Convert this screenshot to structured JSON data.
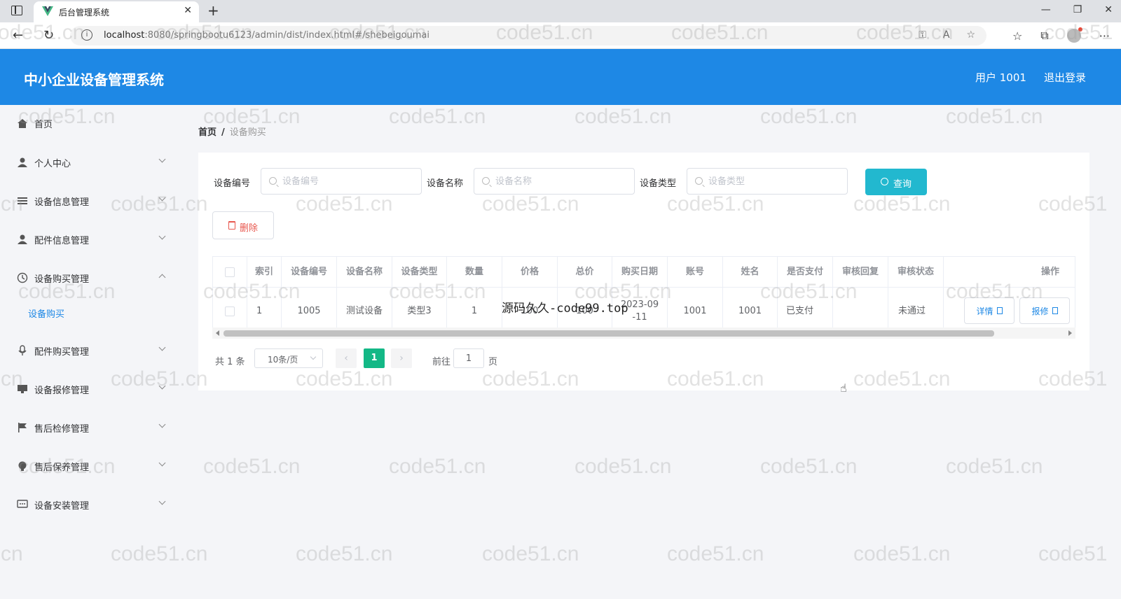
{
  "browser": {
    "tab_title": "后台管理系统",
    "url_host": "localhost",
    "url_rest": ":8080/springbootu6123/admin/dist/index.html#/shebeigoumai"
  },
  "header": {
    "title": "中小企业设备管理系统",
    "user": "用户 1001",
    "logout": "退出登录",
    "color": "#1e88e5"
  },
  "sidebar": {
    "items": [
      {
        "label": "首页",
        "icon": "home-icon"
      },
      {
        "label": "个人中心",
        "icon": "user-icon"
      },
      {
        "label": "设备信息管理",
        "icon": "list-icon"
      },
      {
        "label": "配件信息管理",
        "icon": "user-icon"
      },
      {
        "label": "设备购买管理",
        "icon": "clock-icon"
      },
      {
        "label": "配件购买管理",
        "icon": "mic-icon"
      },
      {
        "label": "设备报修管理",
        "icon": "monitor-icon"
      },
      {
        "label": "售后检修管理",
        "icon": "flag-icon"
      },
      {
        "label": "售后保养管理",
        "icon": "bulb-icon"
      },
      {
        "label": "设备安装管理",
        "icon": "chat-icon"
      }
    ],
    "active_sub": "设备购买"
  },
  "breadcrumb": {
    "home": "首页",
    "sep": "/",
    "current": "设备购买"
  },
  "search": {
    "field1_label": "设备编号",
    "field1_placeholder": "设备编号",
    "field2_label": "设备名称",
    "field2_placeholder": "设备名称",
    "field3_label": "设备类型",
    "field3_placeholder": "设备类型",
    "query_button": "查询"
  },
  "actions": {
    "delete_button": "删除"
  },
  "table": {
    "headers": [
      "索引",
      "设备编号",
      "设备名称",
      "设备类型",
      "数量",
      "价格",
      "总价",
      "购买日期",
      "账号",
      "姓名",
      "是否支付",
      "审核回复",
      "审核状态",
      "操作"
    ],
    "rows": [
      {
        "index": "1",
        "code": "1005",
        "name": "测试设备",
        "type": "类型3",
        "qty": "1",
        "price": "100",
        "total": "100",
        "date": "2023-09-11",
        "account": "1001",
        "person": "1001",
        "paid": "已支付",
        "reply": "",
        "status": "未通过",
        "btn_detail": "详情",
        "btn_repair": "报修"
      }
    ]
  },
  "pagination": {
    "total": "共 1 条",
    "page_size": "10条/页",
    "current_page": "1",
    "goto_label": "前往",
    "goto_value": "1",
    "page_suffix": "页",
    "accent": "#13b886"
  },
  "overlay": {
    "text": "源码久久-code99.top",
    "watermark": "code51.cn"
  }
}
